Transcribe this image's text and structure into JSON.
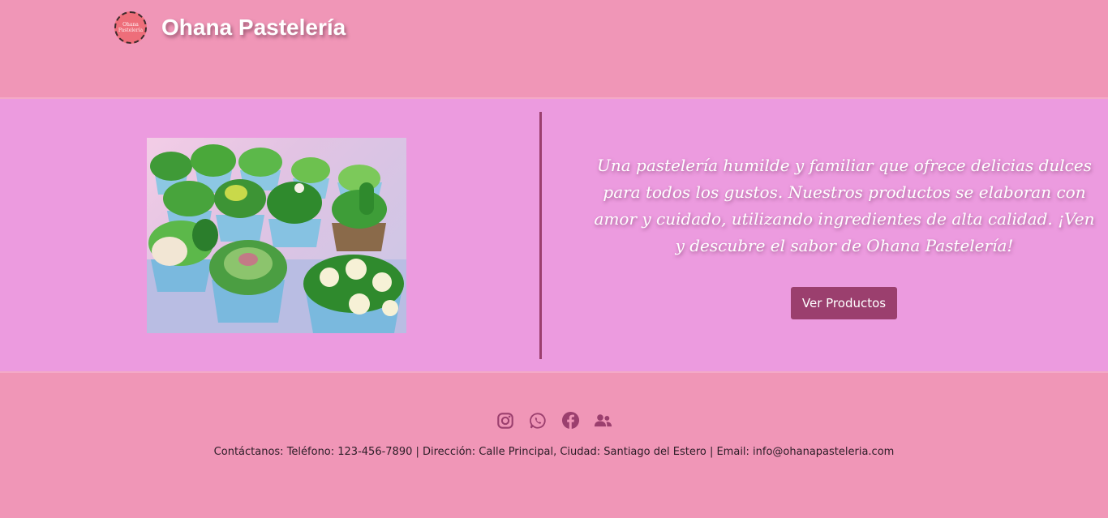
{
  "header": {
    "logo_text": "Ohana\nPastelería",
    "brand": "Ohana Pastelería"
  },
  "hero": {
    "image_alt": "Cupcakes decorados como suculentas y cactus",
    "description": "Una pastelería humilde y familiar que ofrece delicias dulces para todos los gustos. Nuestros productos se elaboran con amor y cuidado, utilizando ingredientes de alta calidad. ¡Ven y descubre el sabor de Ohana Pastelería!",
    "cta_label": "Ver Productos"
  },
  "footer": {
    "socials": [
      {
        "icon": "instagram-icon"
      },
      {
        "icon": "whatsapp-icon"
      },
      {
        "icon": "facebook-icon"
      },
      {
        "icon": "users-icon"
      }
    ],
    "contact": "Contáctanos: Teléfono: 123-456-7890 | Dirección: Calle Principal, Ciudad: Santiago del Estero | Email: info@ohanapasteleria.com"
  },
  "colors": {
    "page_bg": "#f096b7",
    "hero_bg": "#ec9bdf",
    "accent": "#9b3f6e"
  }
}
